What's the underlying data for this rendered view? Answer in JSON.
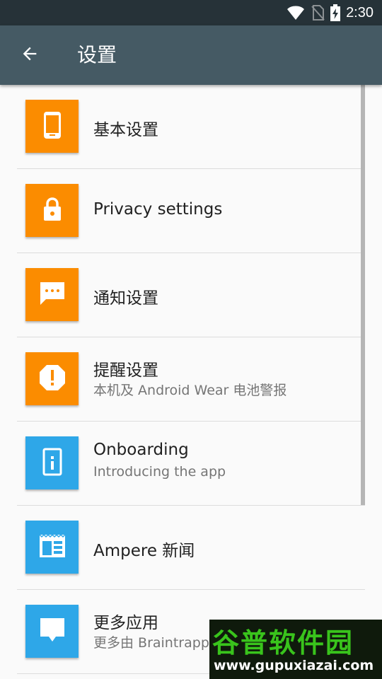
{
  "status_bar": {
    "time": "2:30",
    "icons": [
      "wifi-icon",
      "no-sim-icon",
      "battery-charging-icon"
    ]
  },
  "app_bar": {
    "title": "设置",
    "back_icon": "arrow-back-icon"
  },
  "settings": {
    "items": [
      {
        "title": "基本设置",
        "subtitle": "",
        "icon": "phone-icon",
        "color": "#fb8c00"
      },
      {
        "title": "Privacy settings",
        "subtitle": "",
        "icon": "lock-icon",
        "color": "#fb8c00"
      },
      {
        "title": "通知设置",
        "subtitle": "",
        "icon": "message-icon",
        "color": "#fb8c00"
      },
      {
        "title": "提醒设置",
        "subtitle": "本机及 Android Wear 电池警报",
        "icon": "alert-icon",
        "color": "#fb8c00"
      },
      {
        "title": "Onboarding",
        "subtitle": "Introducing the app",
        "icon": "info-icon",
        "color": "#2ea7e8"
      },
      {
        "title": "Ampere 新闻",
        "subtitle": "",
        "icon": "news-icon",
        "color": "#2ea7e8"
      },
      {
        "title": "更多应用",
        "subtitle": "更多由 Braintrapp",
        "icon": "chat-icon",
        "color": "#2ea7e8"
      }
    ]
  },
  "watermark": {
    "title": "谷普软件园",
    "url": "www.gupuxiazai.com"
  },
  "colors": {
    "status_bar": "#263238",
    "app_bar": "#455a64",
    "orange_tile": "#fb8c00",
    "blue_tile": "#2ea7e8",
    "background": "#fafafa"
  }
}
